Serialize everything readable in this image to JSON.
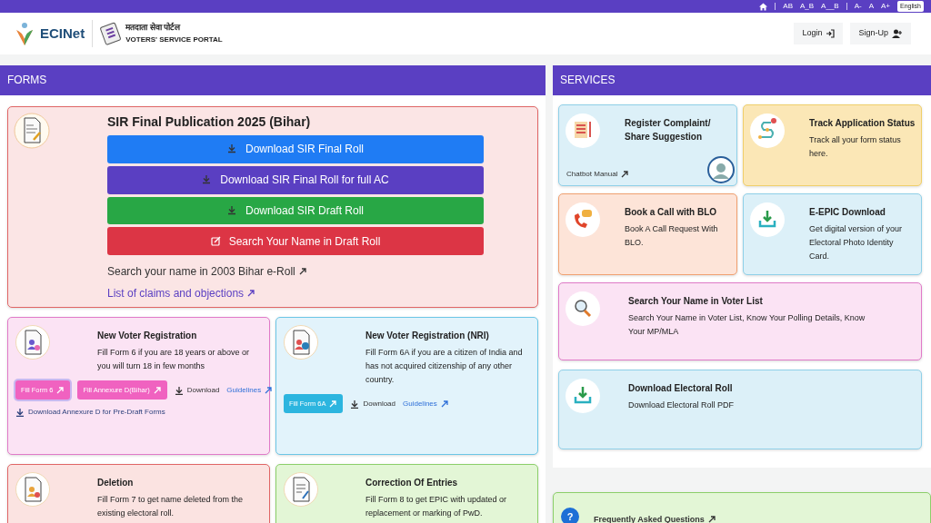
{
  "top_bar": {
    "items": [
      "AB",
      "A_B",
      "A__B",
      "A-",
      "A",
      "A+"
    ],
    "language": "English"
  },
  "header": {
    "logo_text": "ECINet",
    "portal_title_hindi": "मतदाता सेवा पोर्टल",
    "portal_title": "VOTERS' SERVICE PORTAL",
    "actions": [
      "Login",
      "Sign-Up"
    ]
  },
  "forms": {
    "title": "FORMS",
    "sir": {
      "title": "SIR Final Publication 2025 (Bihar)",
      "buttons": [
        {
          "label": "Download SIR Final Roll",
          "kind": "download",
          "color": "#1f7cf4"
        },
        {
          "label": "Download SIR Final Roll for full AC",
          "kind": "download",
          "color": "#5a3fc2"
        },
        {
          "label": "Download SIR Draft Roll",
          "kind": "download",
          "color": "#28a745"
        },
        {
          "label": "Search Your Name in Draft Roll",
          "kind": "edit",
          "color": "#dc3545"
        }
      ],
      "links": [
        {
          "label": "Search your name in 2003 Bihar e-Roll",
          "kind": "plain"
        },
        {
          "label": "List of claims and objections",
          "kind": "accent"
        }
      ]
    },
    "cards": [
      {
        "title": "New Voter Registration",
        "description": "Fill Form 6 if you are 18 years or above or you will turn 18 in few months",
        "color": "#fbe3f4",
        "actions": [
          {
            "kind": "button",
            "label": "Fill Form 6",
            "color": "#f062c0",
            "focused": true
          },
          {
            "kind": "button",
            "label": "Fill Annexure D(Bihar)",
            "color": "#f062c0",
            "focused": false
          },
          {
            "kind": "download",
            "label": "Download"
          },
          {
            "kind": "link",
            "label": "Guidelines"
          }
        ],
        "extra_link": "Download Annexure D for Pre-Draft Forms"
      },
      {
        "title": "New Voter Registration (NRI)",
        "description": "Fill Form 6A if you are a citizen of India and has not acquired citizenship of any other country.",
        "color": "#e2f3fb",
        "actions": [
          {
            "kind": "button",
            "label": "Fill Form 6A",
            "color": "#2cb5df",
            "focused": false
          },
          {
            "kind": "download",
            "label": "Download"
          },
          {
            "kind": "link",
            "label": "Guidelines"
          }
        ]
      },
      {
        "title": "Deletion",
        "description": "Fill Form 7 to get name deleted from the existing electoral roll.",
        "color": "#fbe3e1"
      },
      {
        "title": "Correction Of Entries",
        "description": "Fill Form 8 to get EPIC with updated or replacement or marking of PwD.",
        "color": "#e3f6d6"
      }
    ]
  },
  "services": {
    "title": "SERVICES",
    "cards": [
      {
        "title": "Register Complaint/ Share Suggestion",
        "color": "#dcf0f8",
        "link": "Chatbot Manual"
      },
      {
        "title": "Track Application Status",
        "description": "Track all your form status here.",
        "color": "#fbe7b6"
      },
      {
        "title": "Book a Call with BLO",
        "description": "Book A Call Request With BLO.",
        "color": "#fde4d8"
      },
      {
        "title": "E-EPIC Download",
        "description": "Get digital version of your Electoral Photo Identity Card.",
        "color": "#dcf0f8"
      },
      {
        "title": "Search Your Name in Voter List",
        "description": "Search Your Name in Voter List, Know Your Polling Details, Know Your MP/MLA",
        "color": "#fbe3f4"
      },
      {
        "title": "Download Electoral Roll",
        "description": "Download Electoral Roll PDF",
        "color": "#dcf0f8"
      }
    ]
  },
  "faq": {
    "icon_text": "?",
    "label": "Frequently Asked Questions"
  }
}
